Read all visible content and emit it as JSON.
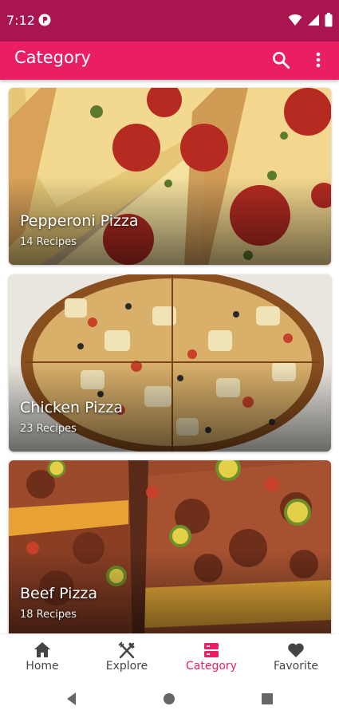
{
  "status_bar": {
    "time": "7:12"
  },
  "app_bar": {
    "title": "Category",
    "search_icon": "search-icon",
    "more_icon": "more-vert-icon"
  },
  "categories": [
    {
      "name": "Pepperoni Pizza",
      "count": "14 Recipes"
    },
    {
      "name": "Chicken Pizza",
      "count": "23 Recipes"
    },
    {
      "name": "Beef Pizza",
      "count": "18 Recipes"
    }
  ],
  "bottom_nav": {
    "items": [
      {
        "label": "Home",
        "icon": "home-icon"
      },
      {
        "label": "Explore",
        "icon": "fork-knife-icon"
      },
      {
        "label": "Category",
        "icon": "category-icon"
      },
      {
        "label": "Favorite",
        "icon": "heart-icon"
      }
    ],
    "selected": "Category"
  },
  "colors": {
    "primary": "#e91e63",
    "status_bar": "#a8154f",
    "inactive": "#444444"
  }
}
